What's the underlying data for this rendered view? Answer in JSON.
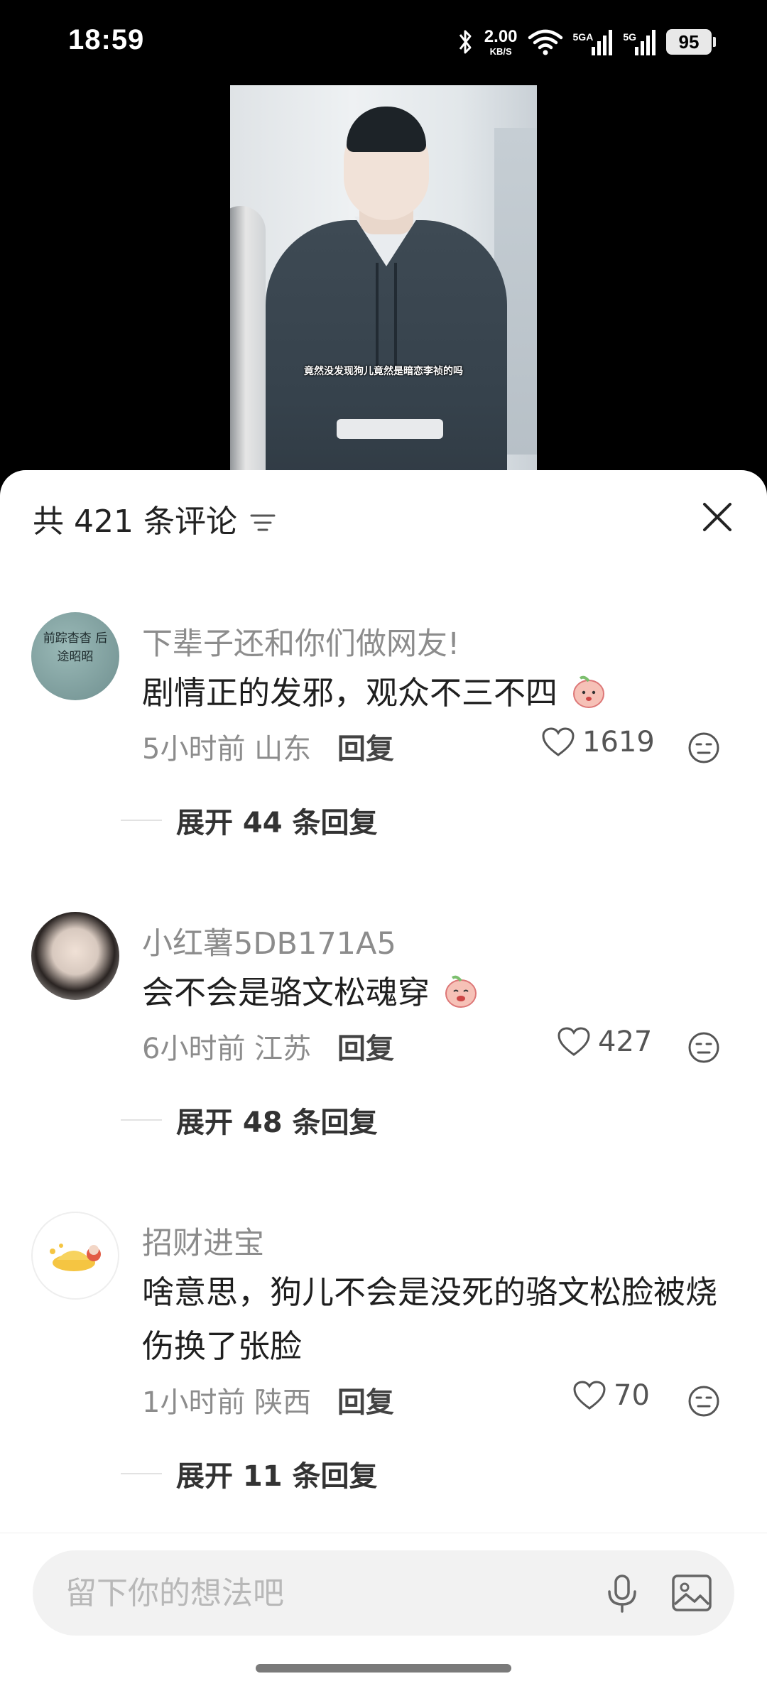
{
  "status_bar": {
    "time": "18:59",
    "net_speed_value": "2.00",
    "net_speed_unit": "KB/S",
    "signal1_label": "5GA",
    "signal2_label": "5G",
    "battery": "95"
  },
  "video": {
    "subtitle": "竟然没发现狗儿竟然是暗恋李祯的吗"
  },
  "panel": {
    "title": "共 421 条评论"
  },
  "comments": [
    {
      "username": "下辈子还和你们做网友!",
      "avatar_text": "前踪杳杳 后途昭昭",
      "text": "剧情正的发邪，观众不三不四",
      "time": "5小时前",
      "location": "山东",
      "reply_label": "回复",
      "likes": "1619",
      "expand_label": "展开 44 条回复"
    },
    {
      "username": "小红薯5DB171A5",
      "text": "会不会是骆文松魂穿",
      "time": "6小时前",
      "location": "江苏",
      "reply_label": "回复",
      "likes": "427",
      "expand_label": "展开 48 条回复"
    },
    {
      "username": "招财进宝",
      "text": "啥意思，狗儿不会是没死的骆文松脸被烧伤换了张脸",
      "time": "1小时前",
      "location": "陕西",
      "reply_label": "回复",
      "likes": "70",
      "expand_label": "展开 11 条回复"
    }
  ],
  "input": {
    "placeholder": "留下你的想法吧"
  },
  "colors": {
    "panel_bg": "#ffffff",
    "meta_gray": "#8c8c8c",
    "input_bg": "#f2f2f2"
  }
}
